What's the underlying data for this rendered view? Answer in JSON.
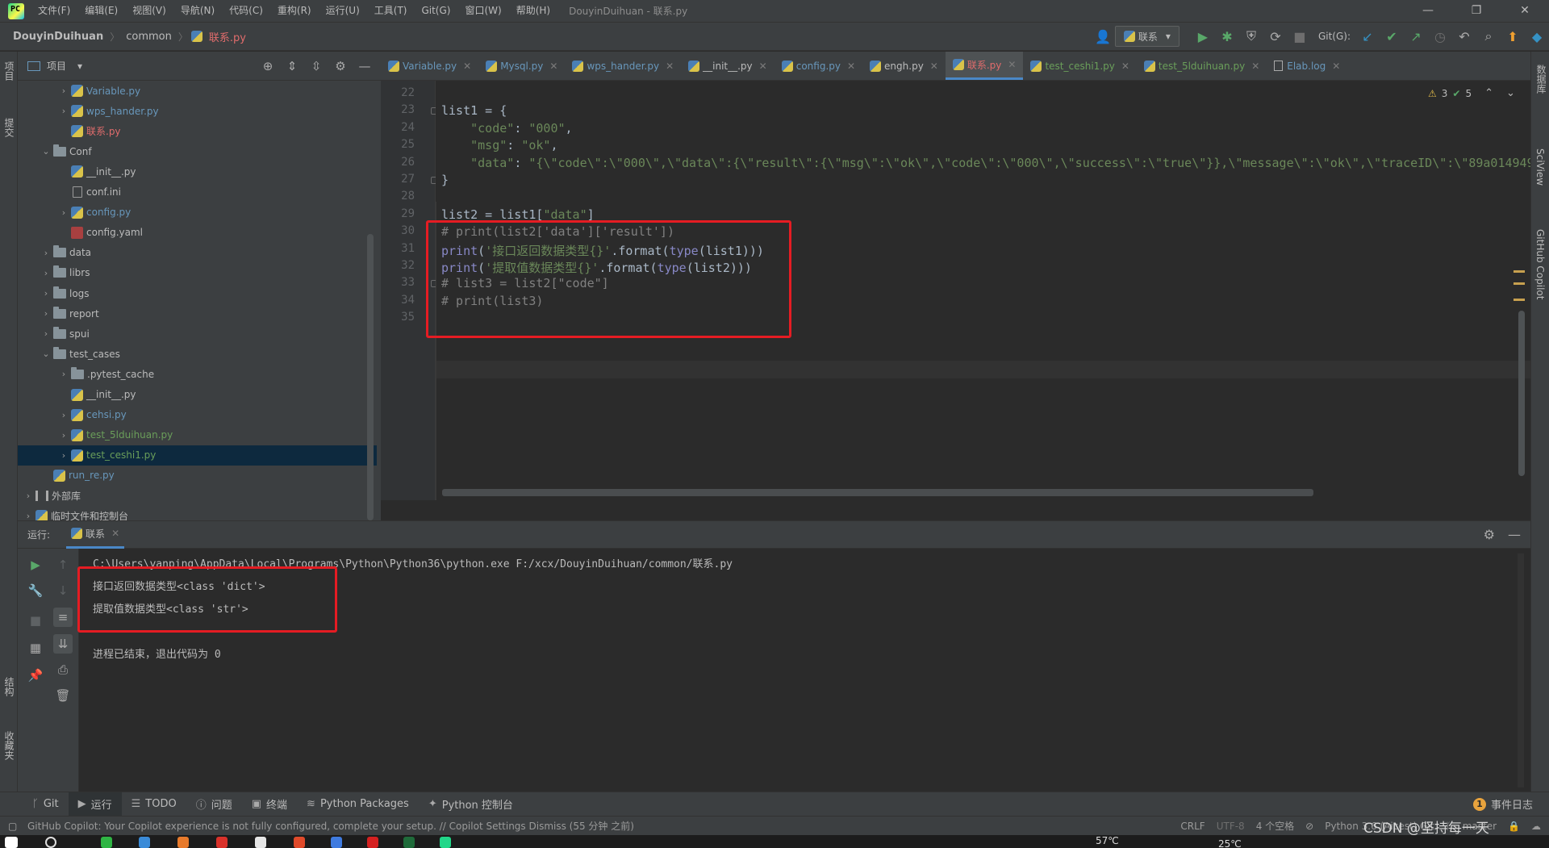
{
  "menubar": {
    "logo_text": "PC",
    "items": [
      "文件(F)",
      "编辑(E)",
      "视图(V)",
      "导航(N)",
      "代码(C)",
      "重构(R)",
      "运行(U)",
      "工具(T)",
      "Git(G)",
      "窗口(W)",
      "帮助(H)"
    ],
    "window_title": "DouyinDuihuan - 联系.py",
    "controls": [
      "—",
      "❐",
      "✕"
    ]
  },
  "navbar": {
    "project": "DouyinDuihuan",
    "folder": "common",
    "file": "联系.py",
    "run_config": "联系",
    "git_label": "Git(G):"
  },
  "left_strip": {
    "project_tab": "项目",
    "commit_tab": "提交",
    "structure_tab": "结构",
    "favorites_tab": "收藏夹"
  },
  "right_strip": {
    "database_tab": "数据库",
    "sciview_tab": "SciView",
    "copilot_tab": "GitHub Copilot"
  },
  "project_panel": {
    "title": "项目",
    "tree": [
      {
        "label": "Variable.py",
        "indent": 2,
        "arrow": "›",
        "icon": "py",
        "color": "blue"
      },
      {
        "label": "wps_hander.py",
        "indent": 2,
        "arrow": "›",
        "icon": "py",
        "color": "blue"
      },
      {
        "label": "联系.py",
        "indent": 2,
        "arrow": "",
        "icon": "py",
        "color": "red"
      },
      {
        "label": "Conf",
        "indent": 1,
        "arrow": "⌄",
        "icon": "folder",
        "color": ""
      },
      {
        "label": "__init__.py",
        "indent": 2,
        "arrow": "",
        "icon": "py",
        "color": ""
      },
      {
        "label": "conf.ini",
        "indent": 2,
        "arrow": "",
        "icon": "ini",
        "color": ""
      },
      {
        "label": "config.py",
        "indent": 2,
        "arrow": "›",
        "icon": "py",
        "color": "blue"
      },
      {
        "label": "config.yaml",
        "indent": 2,
        "arrow": "",
        "icon": "yaml",
        "color": ""
      },
      {
        "label": "data",
        "indent": 1,
        "arrow": "›",
        "icon": "folder",
        "color": ""
      },
      {
        "label": "librs",
        "indent": 1,
        "arrow": "›",
        "icon": "folder",
        "color": ""
      },
      {
        "label": "logs",
        "indent": 1,
        "arrow": "›",
        "icon": "folder",
        "color": ""
      },
      {
        "label": "report",
        "indent": 1,
        "arrow": "›",
        "icon": "folder",
        "color": ""
      },
      {
        "label": "spui",
        "indent": 1,
        "arrow": "›",
        "icon": "folder",
        "color": ""
      },
      {
        "label": "test_cases",
        "indent": 1,
        "arrow": "⌄",
        "icon": "folder",
        "color": ""
      },
      {
        "label": ".pytest_cache",
        "indent": 2,
        "arrow": "›",
        "icon": "folder",
        "color": ""
      },
      {
        "label": "__init__.py",
        "indent": 2,
        "arrow": "",
        "icon": "py",
        "color": ""
      },
      {
        "label": "cehsi.py",
        "indent": 2,
        "arrow": "›",
        "icon": "py",
        "color": "blue"
      },
      {
        "label": "test_5lduihuan.py",
        "indent": 2,
        "arrow": "›",
        "icon": "py",
        "color": "green"
      },
      {
        "label": "test_ceshi1.py",
        "indent": 2,
        "arrow": "›",
        "icon": "py",
        "color": "green",
        "selected": true
      },
      {
        "label": "run_re.py",
        "indent": 1,
        "arrow": "",
        "icon": "py",
        "color": "blue"
      },
      {
        "label": "外部库",
        "indent": 0,
        "arrow": "›",
        "icon": "lib",
        "color": ""
      },
      {
        "label": "临时文件和控制台",
        "indent": 0,
        "arrow": "›",
        "icon": "scratch",
        "color": ""
      }
    ]
  },
  "editor_tabs": [
    {
      "label": "Variable.py",
      "style": "blue"
    },
    {
      "label": "Mysql.py",
      "style": "blue"
    },
    {
      "label": "wps_hander.py",
      "style": "blue"
    },
    {
      "label": "__init__.py",
      "style": "plain"
    },
    {
      "label": "config.py",
      "style": "blue"
    },
    {
      "label": "engh.py",
      "style": "plain"
    },
    {
      "label": "联系.py",
      "style": "active"
    },
    {
      "label": "test_ceshi1.py",
      "style": "green"
    },
    {
      "label": "test_5lduihuan.py",
      "style": "green"
    },
    {
      "label": "Elab.log",
      "style": "blue"
    }
  ],
  "inspections": {
    "warnings": "3",
    "ok": "5"
  },
  "code": {
    "line_numbers": [
      "22",
      "23",
      "24",
      "25",
      "26",
      "27",
      "28",
      "29",
      "30",
      "31",
      "32",
      "33",
      "34",
      "35"
    ],
    "lines": [
      "",
      "list1 = {",
      "    \"code\": \"000\",",
      "    \"msg\": \"ok\",",
      "    \"data\": \"{\\\"code\\\":\\\"000\\\",\\\"data\\\":{\\\"result\\\":{\\\"msg\\\":\\\"ok\\\",\\\"code\\\":\\\"000\\\",\\\"success\\\":\\\"true\\\"}},\\\"message\\\":\\\"ok\\\",\\\"traceID\\\":\\\"89a014949",
      "}",
      "",
      "list2 = list1[\"data\"]",
      "# print(list2['data']['result'])",
      "print('接口返回数据类型{}'.format(type(list1)))",
      "print('提取值数据类型{}'.format(type(list2)))",
      "# list3 = list2[\"code\"]",
      "# print(list3)",
      ""
    ]
  },
  "run_panel": {
    "label": "运行:",
    "tab": "联系",
    "console": [
      "C:\\Users\\yanping\\AppData\\Local\\Programs\\Python\\Python36\\python.exe F:/xcx/DouyinDuihuan/common/联系.py",
      "接口返回数据类型<class 'dict'>",
      "提取值数据类型<class 'str'>",
      "",
      "进程已结束，退出代码为 0"
    ]
  },
  "bottom_tools": {
    "git": "Git",
    "run": "运行",
    "todo": "TODO",
    "problems": "问题",
    "terminal": "终端",
    "packages": "Python Packages",
    "console": "Python 控制台",
    "event_log": "事件日志",
    "event_count": "1"
  },
  "statusbar": {
    "message": "GitHub Copilot: Your Copilot experience is not fully configured, complete your setup. // Copilot Settings   Dismiss (55 分钟 之前)",
    "line_sep": "CRLF",
    "encoding": "UTF-8",
    "indent": "4 个空格",
    "interpreter": "Python 3.6 (Aicest) Git",
    "branch": "master"
  },
  "watermark": "CSDN @坚持每一天",
  "taskbar": {
    "temperature": "57℃",
    "weather": "25℃"
  }
}
